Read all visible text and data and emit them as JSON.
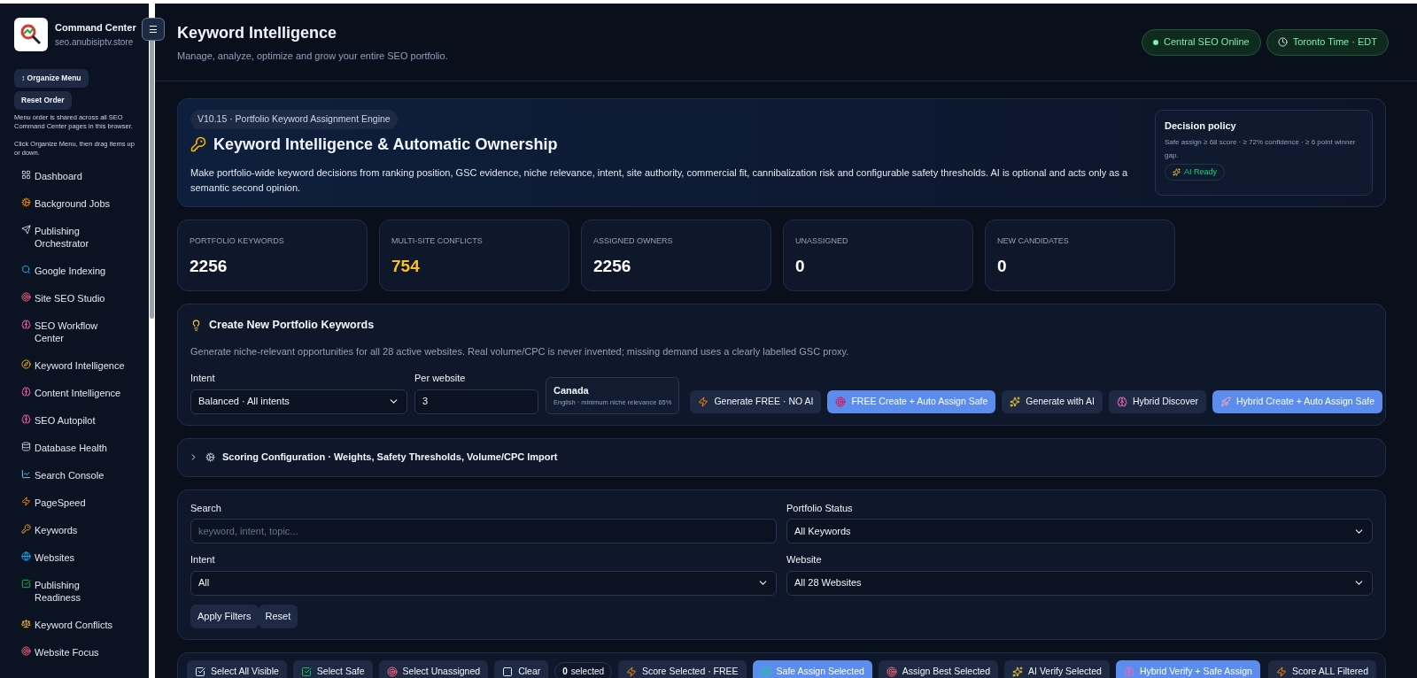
{
  "sidebar": {
    "brand": {
      "title": "Command Center",
      "subtitle": "seo.anubisiptv.store"
    },
    "menu_toggle": "☰",
    "organize_button": "↕ Organize Menu",
    "reset_button": "Reset Order",
    "note_1": "Menu order is shared across all SEO Command Center pages in this browser.",
    "note_2": "Click Organize Menu, then drag items up or down.",
    "items": [
      {
        "label": "Dashboard",
        "selected": false
      },
      {
        "label": "Background Jobs",
        "selected": false
      },
      {
        "label": "Publishing Orchestrator",
        "selected": false
      },
      {
        "label": "Google Indexing",
        "selected": false
      },
      {
        "label": "Site SEO Studio",
        "selected": false
      },
      {
        "label": "SEO Workflow Center",
        "selected": false
      },
      {
        "label": "Keyword Intelligence",
        "selected": false
      },
      {
        "label": "Content Intelligence",
        "selected": false
      },
      {
        "label": "SEO Autopilot",
        "selected": false
      },
      {
        "label": "Database Health",
        "selected": false
      },
      {
        "label": "Search Console",
        "selected": false
      },
      {
        "label": "PageSpeed",
        "selected": false
      },
      {
        "label": "Keywords",
        "selected": false
      },
      {
        "label": "Websites",
        "selected": false
      },
      {
        "label": "Publishing Readiness",
        "selected": false
      },
      {
        "label": "Keyword Conflicts",
        "selected": false
      },
      {
        "label": "Website Focus",
        "selected": false
      }
    ]
  },
  "header": {
    "title": "Keyword Intelligence",
    "subtitle": "Manage, analyze, optimize and grow your entire SEO portfolio.",
    "badges": [
      {
        "label": "Central SEO Online",
        "kind": "dot"
      },
      {
        "label": "Toronto Time · EDT",
        "kind": "clock"
      }
    ]
  },
  "hero": {
    "tag": "V10.15 · Portfolio Keyword Assignment Engine",
    "title": "Keyword Intelligence & Automatic Ownership",
    "description": "Make portfolio-wide keyword decisions from ranking position, GSC evidence, niche relevance, intent, site authority, commercial fit, cannibalization risk and configurable safety thresholds. AI is optional and acts only as a semantic second opinion.",
    "policy": {
      "title": "Decision policy",
      "text": "Safe assign ≥ 68 score · ≥ 72% confidence · ≥ 6 point winner gap.",
      "badge": "AI Ready"
    }
  },
  "stats": [
    {
      "label": "PORTFOLIO KEYWORDS",
      "value": "2256",
      "color": "#ffffff"
    },
    {
      "label": "MULTI-SITE CONFLICTS",
      "value": "754",
      "color": "#fbbf24"
    },
    {
      "label": "ASSIGNED OWNERS",
      "value": "2256",
      "color": "#ffffff"
    },
    {
      "label": "UNASSIGNED",
      "value": "0",
      "color": "#ffffff"
    },
    {
      "label": "NEW CANDIDATES",
      "value": "0",
      "color": "#ffffff"
    }
  ],
  "create": {
    "title": "Create New Portfolio Keywords",
    "description": "Generate niche-relevant opportunities for all 28 active websites. Real volume/CPC is never invented; missing demand uses a clearly labelled GSC proxy.",
    "intent_label": "Intent",
    "intent_value": "Balanced · All intents",
    "per_site_label": "Per website",
    "per_site_value": "3",
    "market": {
      "title": "Canada",
      "text": "English · minimum niche relevance 65%"
    },
    "buttons": [
      {
        "label": "Generate FREE · NO AI",
        "primary": false
      },
      {
        "label": "FREE Create + Auto Assign Safe",
        "primary": true
      },
      {
        "label": "Generate with AI",
        "primary": false
      },
      {
        "label": "Hybrid Discover",
        "primary": false
      },
      {
        "label": "Hybrid Create + Auto Assign Safe",
        "primary": true
      }
    ]
  },
  "scoring": {
    "title": "Scoring Configuration · Weights, Safety Thresholds, Volume/CPC Import",
    "expanded": false
  },
  "filters": {
    "search_label": "Search",
    "search_placeholder": "keyword, intent, topic...",
    "status_label": "Portfolio Status",
    "status_value": "All Keywords",
    "intent_label": "Intent",
    "intent_value": "All",
    "website_label": "Website",
    "website_value": "All 28 Websites",
    "apply": "Apply Filters",
    "reset": "Reset"
  },
  "toolbar": {
    "buttons": [
      {
        "label": "Select All Visible",
        "primary": false
      },
      {
        "label": "Select Safe",
        "primary": false
      },
      {
        "label": "Select Unassigned",
        "primary": false
      },
      {
        "label": "Clear",
        "primary": false
      }
    ],
    "selected_count": "0",
    "selected_label": "selected",
    "actions": [
      {
        "label": "Score Selected · FREE",
        "primary": false
      },
      {
        "label": "Safe Assign Selected",
        "primary": true
      },
      {
        "label": "Assign Best Selected",
        "primary": false
      },
      {
        "label": "AI Verify Selected",
        "primary": false
      },
      {
        "label": "Hybrid Verify + Safe Assign",
        "primary": true
      }
    ],
    "right": "Score ALL Filtered"
  }
}
